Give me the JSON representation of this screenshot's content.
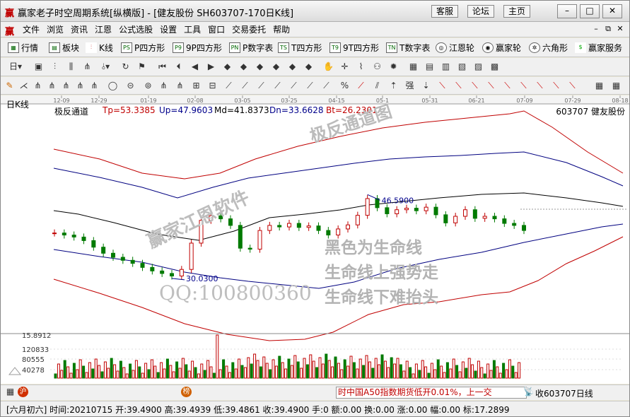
{
  "window": {
    "title": "赢家老子时空周期系统[纵横版] - [健友股份  SH603707-170日K线]",
    "buttons": [
      "客服",
      "论坛",
      "主页"
    ]
  },
  "menu": [
    "文件",
    "浏览",
    "资讯",
    "江恩",
    "公式选股",
    "设置",
    "工具",
    "窗口",
    "交易委托",
    "帮助"
  ],
  "toolbar1": [
    {
      "icon": "grid-icon",
      "label": "行情"
    },
    {
      "icon": "block-icon",
      "label": "板块"
    },
    {
      "icon": "candle-icon",
      "label": "K线"
    },
    {
      "icon": "p-square-icon",
      "label": "P四方形"
    },
    {
      "icon": "p-square-icon",
      "label": "9P四方形"
    },
    {
      "icon": "p-square-icon",
      "label": "P数字表"
    },
    {
      "icon": "t-square-icon",
      "label": "T四方形"
    },
    {
      "icon": "t-square-icon",
      "label": "9T四方形"
    },
    {
      "icon": "tn-icon",
      "label": "T数字表"
    },
    {
      "icon": "wheel-icon",
      "label": "江恩轮"
    },
    {
      "icon": "wheel-icon",
      "label": "赢家轮"
    },
    {
      "icon": "hexagon-icon",
      "label": "六角形"
    },
    {
      "icon": "dollar-icon",
      "label": "赢家服务"
    }
  ],
  "chart": {
    "period_label": "日K线",
    "indicator": {
      "name": "极反通道",
      "tp": "Tp=53.3385",
      "up": "Up=47.9603",
      "md": "Md=41.8373",
      "dn": "Dn=33.6628",
      "bt": "Bt=26.2301"
    },
    "stock_code": "603707",
    "stock_name": "健友股份",
    "dates": [
      "12-09",
      "12-29",
      "01-19",
      "02-08",
      "03-05",
      "03-25",
      "04-15",
      "05-1",
      "05-31",
      "06-21",
      "07-09",
      "07-29",
      "08-18"
    ],
    "high_label": "46.5900",
    "low_label": "30.0300",
    "volume_scale": [
      "15.8912",
      "120833",
      "80555",
      "40278"
    ]
  },
  "watermarks": {
    "channel": "极反通道图",
    "software": "赢家江恩软件",
    "qq": "QQ:100800360",
    "line1": "黑色为生命线",
    "line2": "生命线上强势走",
    "line3": "生命线下难抬头"
  },
  "ticker": "时中国A50指数期货低开0.01%，上一交",
  "bottom_tab": "收603707日线",
  "status": "[六月初六] 时间:20210715 开:39.4900 高:39.4939 低:39.4861 收:39.4900 手:0 额:0.00 换:0.00 涨:0.00 幅:0.00 标:17.2899",
  "chart_data": {
    "type": "candlestick",
    "x_ticks": [
      "12-09",
      "12-29",
      "01-19",
      "02-08",
      "03-05",
      "03-25",
      "04-15",
      "05-1",
      "05-31",
      "06-21",
      "07-09",
      "07-29",
      "08-18"
    ],
    "price_close": [
      39.0,
      38.6,
      38.2,
      37.5,
      36.2,
      35.0,
      34.2,
      33.6,
      33.0,
      32.2,
      31.5,
      31.0,
      30.5,
      31.8,
      37.0,
      41.5,
      42.4,
      41.8,
      40.5,
      36.0,
      35.8,
      39.5,
      40.5,
      40.2,
      40.9,
      40.1,
      40.4,
      39.5,
      38.6,
      39.8,
      40.6,
      42.5,
      45.8,
      44.0,
      42.8,
      43.6,
      43.9,
      43.4,
      44.1,
      42.6,
      41.0,
      42.3,
      43.6,
      41.9,
      42.3,
      41.8,
      40.9,
      40.5,
      39.5
    ],
    "annotations": {
      "high": 46.59,
      "low": 30.03
    },
    "volume_max": 15.8912
  }
}
